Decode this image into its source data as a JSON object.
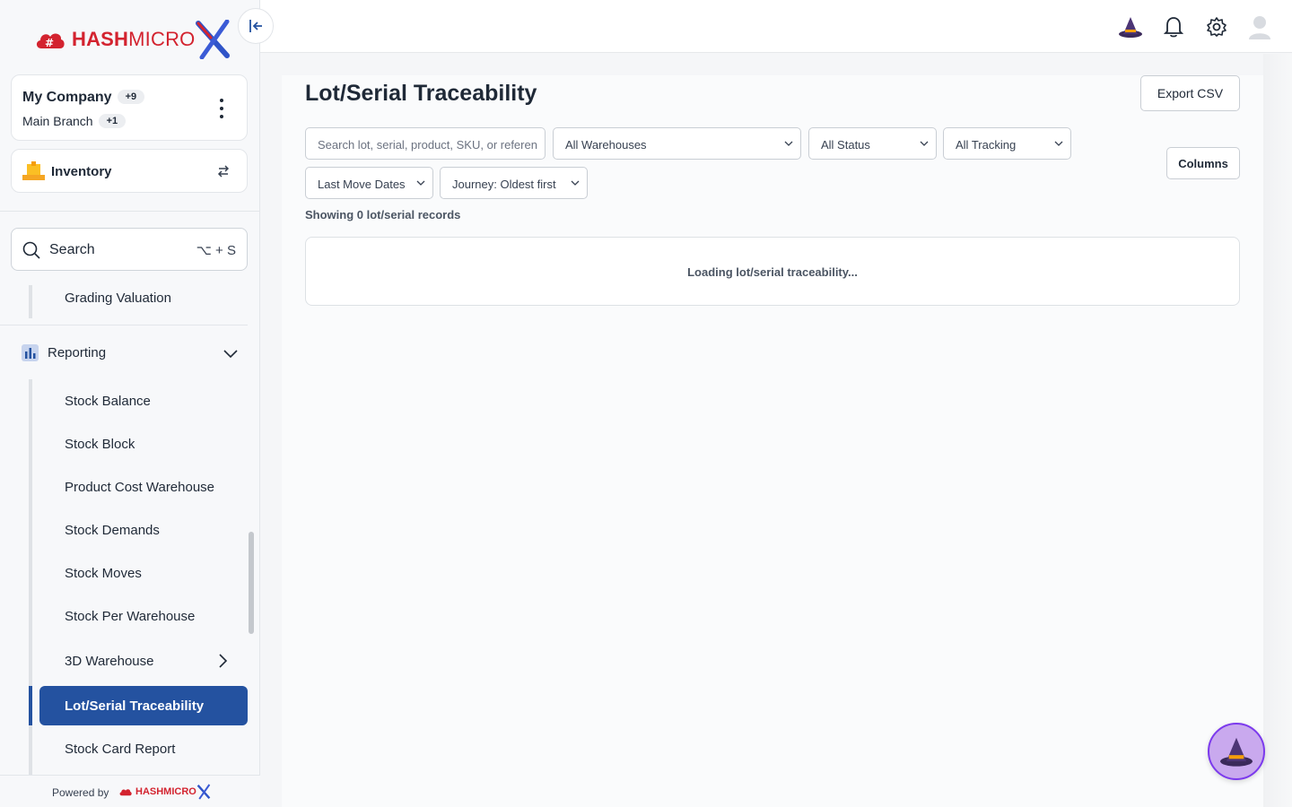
{
  "brand": {
    "name_part1": "HASH",
    "name_part2": "MICRO",
    "footer_powered": "Powered by",
    "footer_name": "HASHMICRO"
  },
  "company": {
    "name": "My Company",
    "name_badge": "+9",
    "branch": "Main Branch",
    "branch_badge": "+1"
  },
  "module": {
    "label": "Inventory"
  },
  "search": {
    "label": "Search",
    "shortcut": "⌥ + S"
  },
  "sidebar": {
    "grading": "Grading Valuation",
    "section": "Reporting",
    "items": [
      "Stock Balance",
      "Stock Block",
      "Product Cost Warehouse",
      "Stock Demands",
      "Stock Moves",
      "Stock Per Warehouse",
      "3D Warehouse",
      "Lot/Serial Traceability",
      "Stock Card Report"
    ]
  },
  "page": {
    "title": "Lot/Serial Traceability",
    "export_label": "Export CSV",
    "columns_label": "Columns",
    "search_placeholder": "Search lot, serial, product, SKU, or reference",
    "filters": {
      "warehouse": "All Warehouses",
      "status": "All Status",
      "tracking": "All Tracking",
      "dates": "Last Move Dates",
      "journey": "Journey: Oldest first"
    },
    "showing": "Showing 0 lot/serial records",
    "loading": "Loading lot/serial traceability..."
  },
  "colors": {
    "accent": "#2452a0",
    "brand_red": "#d3232f",
    "brand_blue": "#2f54c8"
  },
  "icons": [
    "cloud-logo-icon",
    "collapse-icon",
    "kebab-icon",
    "inventory-icon",
    "switch-icon",
    "search-icon",
    "bar-chart-icon",
    "chevron-down-icon",
    "chevron-right-icon",
    "wizard-hat-icon",
    "bell-icon",
    "gear-icon",
    "avatar-icon"
  ]
}
